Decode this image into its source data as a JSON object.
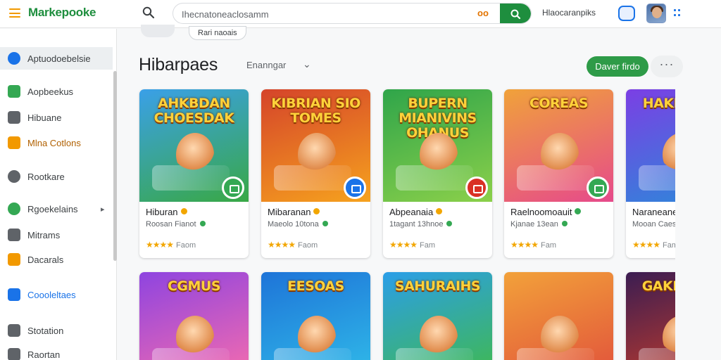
{
  "app": {
    "brand": "Markepooke"
  },
  "search": {
    "value": "Ihecnatoneaclosamm",
    "extra": "oo",
    "link": "Hlaocaranpiks"
  },
  "header": {
    "chips": [
      "",
      "Rari naoais"
    ],
    "title": "Hibarpaes",
    "sort_label": "Enanngar",
    "sort_caret": "⌄",
    "primary_button": "Daver firdo",
    "more_button": "···"
  },
  "sidebar": {
    "items": [
      {
        "label": "Aptuodoebelsie",
        "icon": "compass-icon",
        "color": "#1a73e8",
        "active": true
      },
      {
        "label": "Aopbeekus",
        "icon": "books-icon",
        "color": "#34a853",
        "active": false
      },
      {
        "label": "Hibuane",
        "icon": "grid-icon",
        "color": "#5f6368",
        "active": false
      },
      {
        "label": "Mlna Cotlons",
        "icon": "collection-icon",
        "color": "#f29900",
        "active": false
      },
      {
        "label": "Rootkare",
        "icon": "info-icon",
        "color": "#5f6368",
        "active": false
      },
      {
        "label": "Rgoekelains",
        "icon": "settings-icon",
        "color": "#34a853",
        "active": false,
        "chevron": "▸"
      },
      {
        "label": "Mitrams",
        "icon": "library-icon",
        "color": "#5f6368",
        "active": false
      },
      {
        "label": "Dacarals",
        "icon": "bookmark-icon",
        "color": "#f29900",
        "active": false
      },
      {
        "label": "Coooleltaes",
        "icon": "apps-icon",
        "color": "#1a73e8",
        "active": false
      },
      {
        "label": "Stotation",
        "icon": "chart-icon",
        "color": "#5f6368",
        "active": false
      },
      {
        "label": "Raortan",
        "icon": "account-icon",
        "color": "#5f6368",
        "active": false
      }
    ]
  },
  "cards_row1": [
    {
      "art_title": "AHKBDAN CHOESDAK",
      "name": "Hiburan",
      "sub": "Roosan Fianot",
      "stars": "★★★★",
      "rating_label": "Faom",
      "bg": [
        "#3aa0e8",
        "#39a845"
      ],
      "badge_color": "#34a853",
      "name_dot": "#f2a600"
    },
    {
      "art_title": "KIBRIAN SIO TOMES",
      "name": "Mibaranan",
      "sub": "Maeolo 10tona",
      "stars": "★★★★",
      "rating_label": "Faom",
      "bg": [
        "#d5442a",
        "#f6a21e"
      ],
      "badge_color": "#1a73e8",
      "name_dot": "#f2a600"
    },
    {
      "art_title": "BUPERN MIANIVINS OHANUS",
      "name": "Abpeanaia",
      "sub": "1tagant 13hnoe",
      "stars": "★★★★",
      "rating_label": "Fam",
      "bg": [
        "#2fa54a",
        "#8bd04a"
      ],
      "badge_color": "#d93025",
      "name_dot": "#f2a600"
    },
    {
      "art_title": "COREAS",
      "name": "Raelnoomoauit",
      "sub": "Kjanae 13ean",
      "stars": "★★★★",
      "rating_label": "Fam",
      "bg": [
        "#f0a23a",
        "#e64a8b"
      ],
      "badge_color": "#34a853",
      "name_dot": "#34a853"
    },
    {
      "art_title": "HAKE MAE",
      "name": "Naraneanea",
      "sub": "Mooan Caes",
      "stars": "★★★★",
      "rating_label": "Fam",
      "bg": [
        "#7b3fe4",
        "#2b8ad9"
      ],
      "badge_color": "#f2a600",
      "name_dot": "#34a853"
    }
  ],
  "cards_row2": [
    {
      "art_title": "CGMUS",
      "bg": [
        "#8e44e0",
        "#f06ab0"
      ]
    },
    {
      "art_title": "EESOAS",
      "bg": [
        "#1e74d8",
        "#2fb7e8"
      ]
    },
    {
      "art_title": "SAHURAIHS",
      "bg": [
        "#2b9ee8",
        "#3fb856"
      ]
    },
    {
      "art_title": "",
      "bg": [
        "#f2a13a",
        "#e2563b"
      ]
    },
    {
      "art_title": "GAKK MSR",
      "bg": [
        "#3b1d52",
        "#c23b2b"
      ]
    }
  ]
}
